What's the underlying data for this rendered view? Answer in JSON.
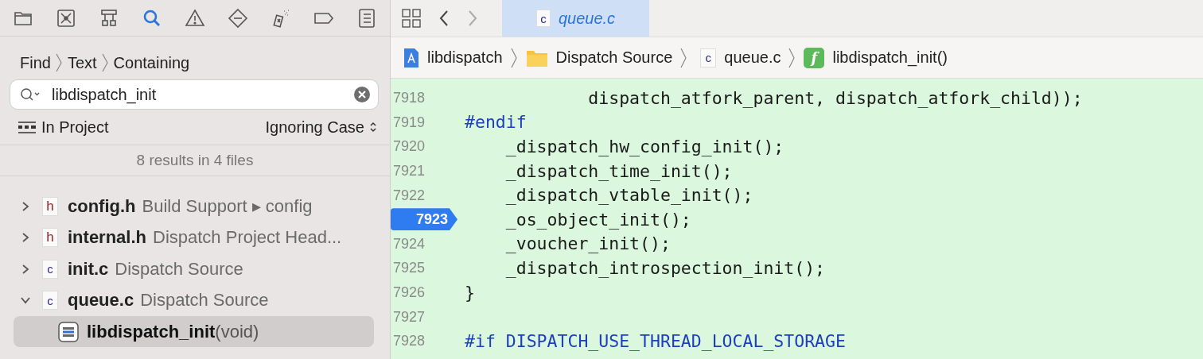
{
  "navigator_toolbar": {
    "items": [
      {
        "kind": "folder",
        "selected": false
      },
      {
        "kind": "source-control",
        "selected": false
      },
      {
        "kind": "hierarchy",
        "selected": false
      },
      {
        "kind": "search",
        "selected": true
      },
      {
        "kind": "warning",
        "selected": false
      },
      {
        "kind": "test",
        "selected": false
      },
      {
        "kind": "debug",
        "selected": false
      },
      {
        "kind": "breakpoint",
        "selected": false
      },
      {
        "kind": "report",
        "selected": false
      }
    ]
  },
  "find": {
    "path": [
      "Find",
      "Text",
      "Containing"
    ],
    "query": "libdispatch_init",
    "scope": "In Project",
    "matching": "Ignoring Case",
    "summary": "8 results in 4 files"
  },
  "results": [
    {
      "file": "config.h",
      "icon_letter": "h",
      "kind": "header",
      "location": "Build Support ▸ config",
      "expanded": false
    },
    {
      "file": "internal.h",
      "icon_letter": "h",
      "kind": "header",
      "location": "Dispatch Project Head...",
      "expanded": false
    },
    {
      "file": "init.c",
      "icon_letter": "c",
      "kind": "source",
      "location": "Dispatch Source",
      "expanded": false
    },
    {
      "file": "queue.c",
      "icon_letter": "c",
      "kind": "source",
      "location": "Dispatch Source",
      "expanded": true,
      "children": [
        {
          "name": "libdispatch_init",
          "signature": "(void)",
          "selected": true
        }
      ]
    }
  ],
  "editor": {
    "tab": {
      "icon_letter": "c",
      "title": "queue.c"
    },
    "breadcrumbs": [
      {
        "kind": "project",
        "label": "libdispatch"
      },
      {
        "kind": "folder",
        "label": "Dispatch Source"
      },
      {
        "kind": "file",
        "label": "queue.c",
        "icon_letter": "c"
      },
      {
        "kind": "function",
        "label": "libdispatch_init()",
        "icon_letter": "f"
      }
    ],
    "lines": [
      {
        "number": "7918",
        "kind": "code",
        "text": "            dispatch_atfork_parent, dispatch_atfork_child));",
        "selected": false
      },
      {
        "number": "7919",
        "kind": "directive",
        "text": "#endif",
        "selected": false
      },
      {
        "number": "7920",
        "kind": "code",
        "text": "    _dispatch_hw_config_init();",
        "selected": false
      },
      {
        "number": "7921",
        "kind": "code",
        "text": "    _dispatch_time_init();",
        "selected": false
      },
      {
        "number": "7922",
        "kind": "code",
        "text": "    _dispatch_vtable_init();",
        "selected": false
      },
      {
        "number": "7923",
        "kind": "code",
        "text": "    _os_object_init();",
        "selected": true
      },
      {
        "number": "7924",
        "kind": "code",
        "text": "    _voucher_init();",
        "selected": false
      },
      {
        "number": "7925",
        "kind": "code",
        "text": "    _dispatch_introspection_init();",
        "selected": false
      },
      {
        "number": "7926",
        "kind": "code",
        "text": "}",
        "selected": false
      },
      {
        "number": "7927",
        "selected": false
      },
      {
        "number": "7928",
        "kind": "directive",
        "text": "#if DISPATCH_USE_THREAD_LOCAL_STORAGE",
        "selected": false
      }
    ]
  }
}
